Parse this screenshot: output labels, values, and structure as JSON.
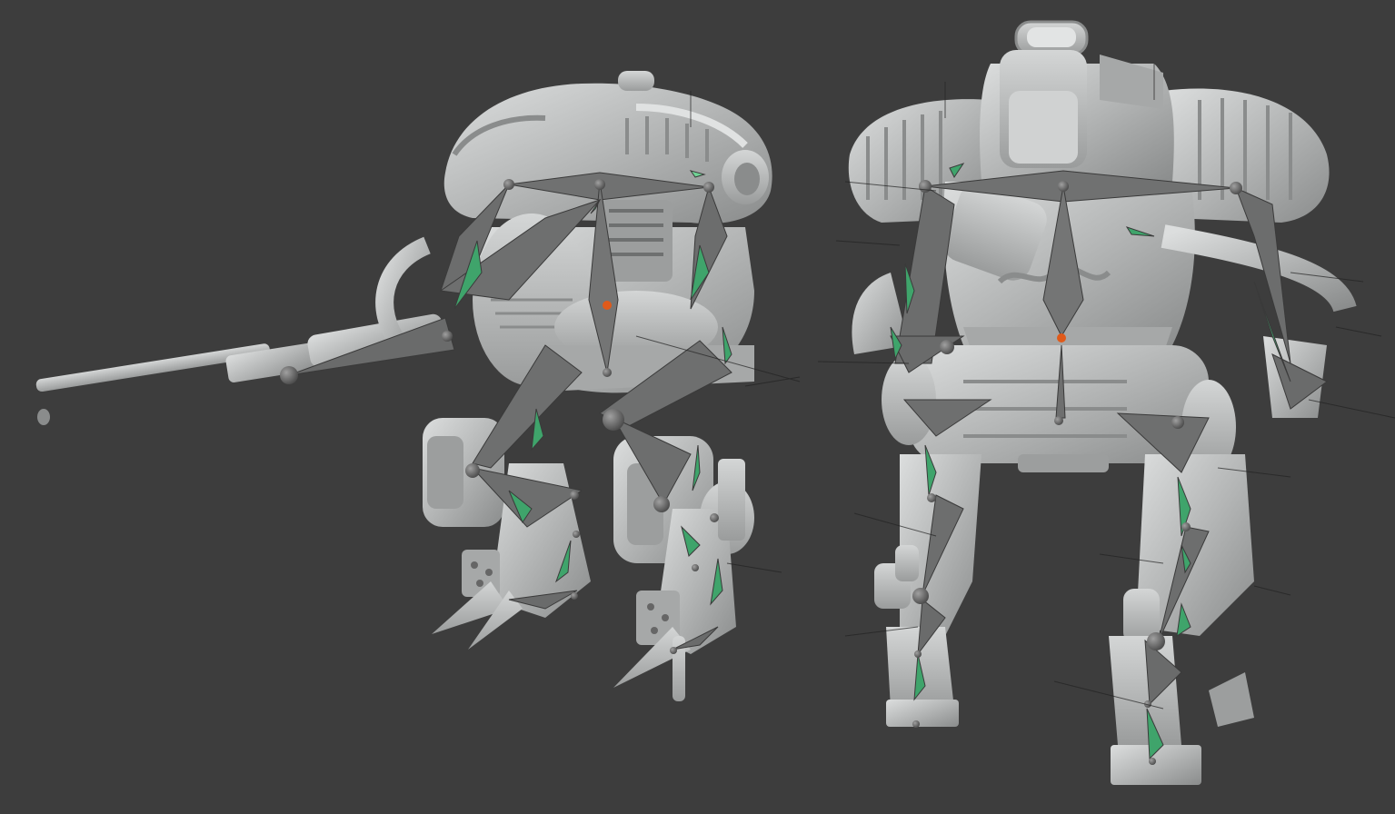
{
  "viewport": {
    "background": "#3d3d3d",
    "model_color": "#b7b9b9",
    "model_shade": "#8e9090",
    "model_light": "#d8dada",
    "bone_color": "#6f7070",
    "bone_edge": "#3a3a3a",
    "bone_accent": "#3fa46b",
    "bone_accent_light": "#6fd294",
    "joint_active": "#e05a1a",
    "objects": [
      {
        "name": "mech-left",
        "view": "three-quarter",
        "weapon": "long-gun"
      },
      {
        "name": "mech-right",
        "view": "back"
      }
    ]
  }
}
